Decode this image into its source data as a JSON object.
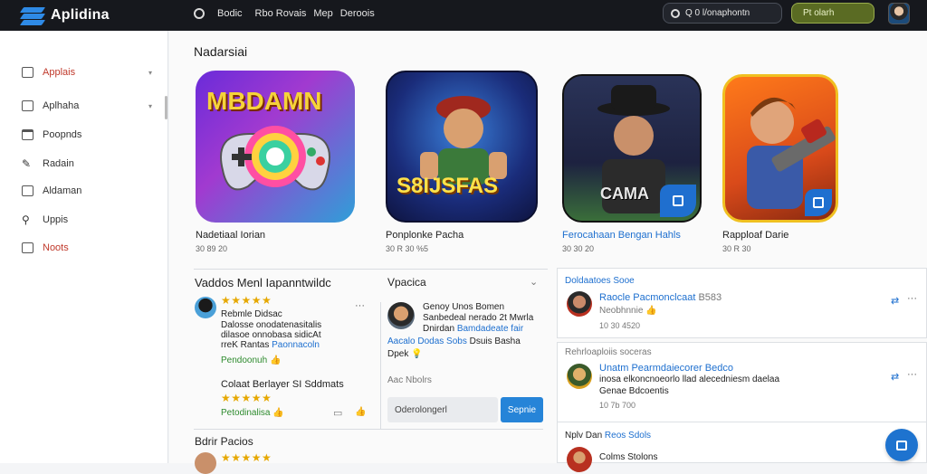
{
  "topbar": {
    "app_name": "Aplidina",
    "nav": [
      "Bodic",
      "Rbo Rovais",
      "Mep",
      "Deroois"
    ],
    "search_text": "Q 0 l/onaphontn",
    "upload_label": "Pt olarh",
    "colors": {
      "bar": "#16181d",
      "accent": "#2e8ae6",
      "upload": "#5a6b23"
    }
  },
  "sidebar": {
    "items": [
      {
        "label": "Applais",
        "icon": "square-icon",
        "chevron": "▾",
        "active": true
      },
      {
        "label": "Aplhaha",
        "icon": "square-icon",
        "chevron": "▾",
        "active": false
      },
      {
        "label": "Poopnds",
        "icon": "window-icon",
        "active": false
      },
      {
        "label": "Radain",
        "icon": "pencil-icon",
        "active": false
      },
      {
        "label": "Aldaman",
        "icon": "picture-icon",
        "active": false
      },
      {
        "label": "Uppis",
        "icon": "pin-icon",
        "active": false
      },
      {
        "label": "Noots",
        "icon": "grid-icon",
        "active": true
      }
    ]
  },
  "featured": {
    "title": "Nadarsiai",
    "cards": [
      {
        "title": "Nadetiaal Iorian",
        "meta": "30 89 20",
        "art_text": "MBDAMN"
      },
      {
        "title": "Ponplonke Pacha",
        "meta": "30 R 30 %5",
        "art_text": "S8IJSFAS"
      },
      {
        "title": "Ferocahaan Bengan Hahls",
        "meta": "30 30 20",
        "art_text": "CAMA"
      },
      {
        "title": "Rapploaf Darie",
        "meta": "30 R 30",
        "art_text": ""
      }
    ]
  },
  "reviews": {
    "title": "Vaddos Menl Iapanntwildc",
    "items": [
      {
        "stars": "★★★★★",
        "line1": "Rebmle Didsac",
        "line2": "Dalosse onodatenasitalis",
        "line3": "dilasoe onnobasa sidicAt",
        "line4": "rreK Rantas",
        "line4_link": "Paonnacoln",
        "link_label": "Pendoonuh",
        "verify_icon": "thumbs-up-icon"
      },
      {
        "name": "Colaat Berlayer SI Sddmats",
        "stars": "★★★★★",
        "link_label": "Petodinalisa",
        "verify_icon": "thumbs-up-icon"
      }
    ],
    "section2_title": "Bdrir Pacios",
    "section2_stars": "★★★★★"
  },
  "messages": {
    "title": "Vpacica",
    "item": {
      "line1": "Genoy Unos Bomen",
      "line2": "Sanbedeal nerado 2t Mwrla",
      "line3_a": "Dnirdan",
      "line3_b": "Bamdadeate fair",
      "line4": "Aacalo Dodas Sobs",
      "line4_b": "Dsuis Basha",
      "line5": "Dpek"
    },
    "hint": "Aac Nbolrs",
    "input_placeholder": "Oderolongerl",
    "send_label": "Sepnie"
  },
  "notifications": {
    "title": "Doldaatoes Sooe",
    "items": [
      {
        "title": "Raocle Pacmonclcaat",
        "extra": "B583",
        "sub": "Neobhnnie",
        "meta": "10 30 4520"
      },
      {
        "header": "Rehrloaploiis soceras",
        "title": "Unatm Pearmdaiecorer Bedco",
        "body": "inosa elkoncnoeorlo llad alecedniesm daelaa",
        "body2": "Genae Bdcoentis",
        "meta": "10 7b 700"
      },
      {
        "header": "Nplv Dan",
        "title": "Reos Sdols",
        "sub": "Colms Stolons"
      }
    ]
  }
}
